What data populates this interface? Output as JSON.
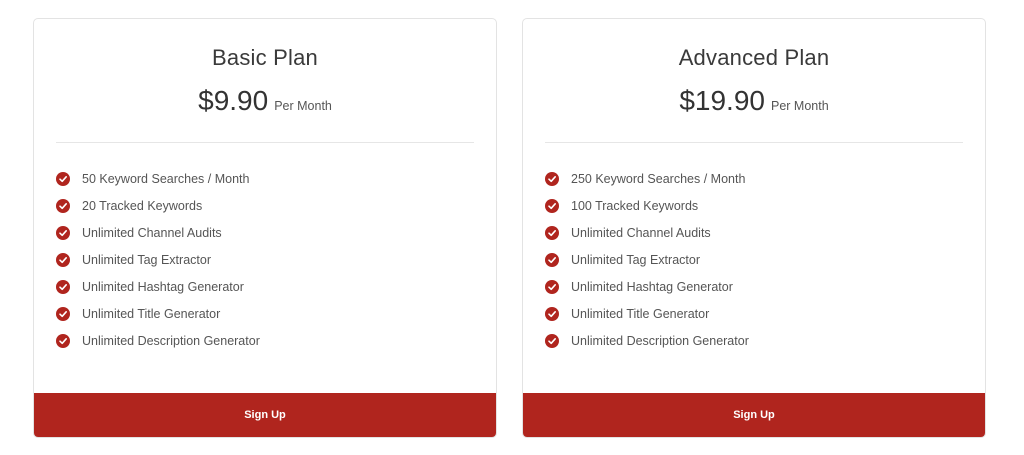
{
  "accent_color": "#b0251e",
  "check_icon": "check-circle-icon",
  "plans": [
    {
      "name": "Basic Plan",
      "price": "$9.90",
      "period": "Per Month",
      "features": [
        "50 Keyword Searches / Month",
        "20 Tracked Keywords",
        "Unlimited Channel Audits",
        "Unlimited Tag Extractor",
        "Unlimited Hashtag Generator",
        "Unlimited Title Generator",
        "Unlimited Description Generator"
      ],
      "button_label": "Sign Up"
    },
    {
      "name": "Advanced Plan",
      "price": "$19.90",
      "period": "Per Month",
      "features": [
        "250 Keyword Searches / Month",
        "100 Tracked Keywords",
        "Unlimited Channel Audits",
        "Unlimited Tag Extractor",
        "Unlimited Hashtag Generator",
        "Unlimited Title Generator",
        "Unlimited Description Generator"
      ],
      "button_label": "Sign Up"
    }
  ]
}
